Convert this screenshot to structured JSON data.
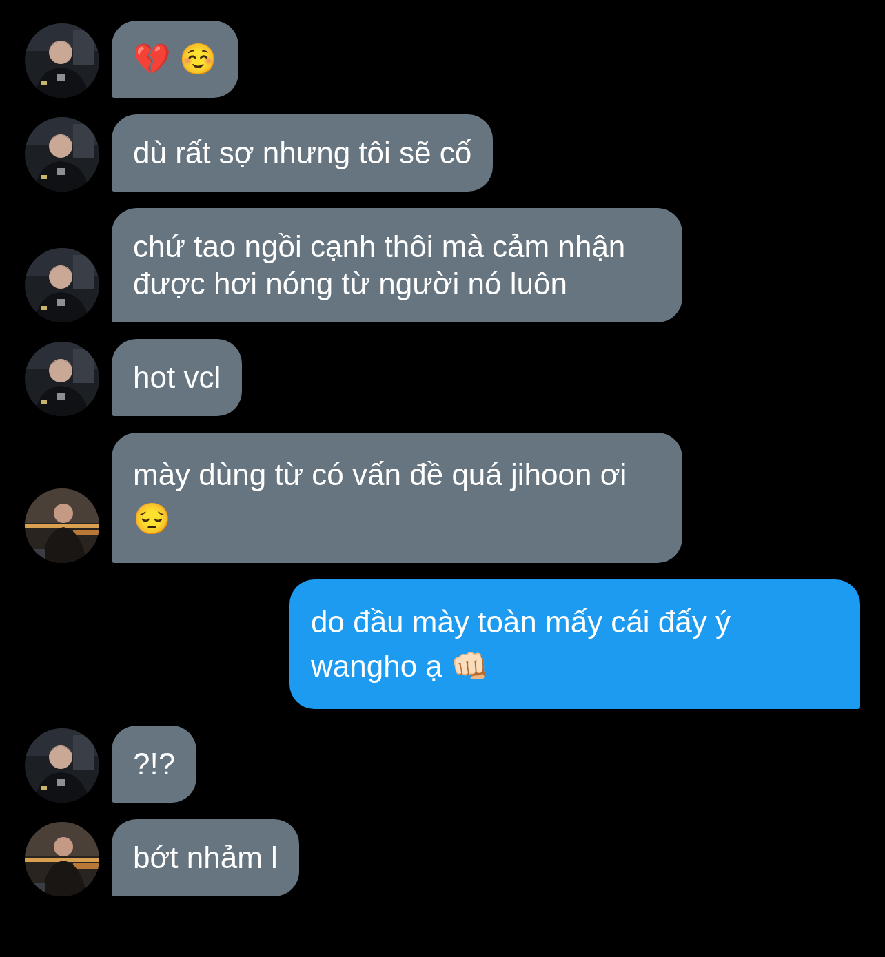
{
  "messages": [
    {
      "kind": "received",
      "text": "💔 ☺️"
    },
    {
      "kind": "received",
      "text": "dù rất sợ nhưng tôi sẽ cố"
    },
    {
      "kind": "received",
      "text": "chứ tao ngồi cạnh thôi mà cảm nhận được hơi nóng từ người nó luôn"
    },
    {
      "kind": "received",
      "text": "hot vcl"
    },
    {
      "kind": "received",
      "text": "mày dùng từ có vấn đề quá jihoon ơi 😔"
    },
    {
      "kind": "sent",
      "text": "do đầu mày toàn mấy cái đấy ý wangho ạ 👊🏻"
    },
    {
      "kind": "received",
      "text": "?!?"
    },
    {
      "kind": "received",
      "text": "bớt nhảm l"
    }
  ]
}
